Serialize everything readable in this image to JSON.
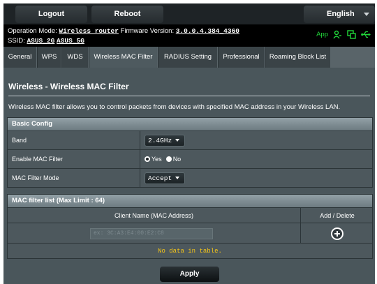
{
  "topbar": {
    "logout_label": "Logout",
    "reboot_label": "Reboot",
    "language": "English"
  },
  "info": {
    "op_mode_label": "Operation Mode:",
    "op_mode_value": "Wireless router",
    "firmware_label": "Firmware Version:",
    "firmware_value": "3.0.0.4.384_4360",
    "ssid_label": "SSID:",
    "ssid_1": "ASUS_2G",
    "ssid_2": "ASUS_5G",
    "app_label": "App",
    "status_color": "#21d63a"
  },
  "tabs": [
    {
      "label": "General"
    },
    {
      "label": "WPS"
    },
    {
      "label": "WDS"
    },
    {
      "label": "Wireless MAC Filter",
      "active": true
    },
    {
      "label": "RADIUS Setting"
    },
    {
      "label": "Professional"
    },
    {
      "label": "Roaming Block List"
    }
  ],
  "page": {
    "title": "Wireless - Wireless MAC Filter",
    "description": "Wireless MAC filter allows you to control packets from devices with specified MAC address in your Wireless LAN."
  },
  "basic_config": {
    "header": "Basic Config",
    "band_label": "Band",
    "band_value": "2.4GHz",
    "enable_label": "Enable MAC Filter",
    "yes_label": "Yes",
    "no_label": "No",
    "enable_value": "Yes",
    "mode_label": "MAC Filter Mode",
    "mode_value": "Accept"
  },
  "mac_list": {
    "header": "MAC filter list (Max Limit : 64)",
    "col_client": "Client Name (MAC Address)",
    "col_action": "Add / Delete",
    "input_placeholder": "ex: 3C:A3:E4:00:E2:C8",
    "empty_text": "No data in table."
  },
  "apply_label": "Apply"
}
